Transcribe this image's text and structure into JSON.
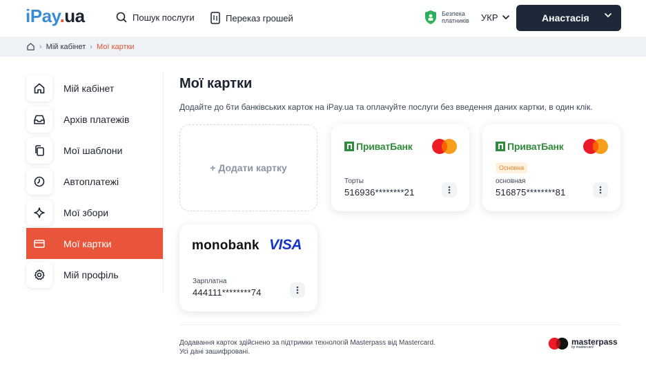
{
  "header": {
    "logo": {
      "part1": "iPay",
      "part2": ".",
      "part3": "ua"
    },
    "search_label": "Пошук послуги",
    "transfer_label": "Переказ грошей",
    "safety_line1": "Безпека",
    "safety_line2": "платників",
    "lang": "УКР",
    "user_name": "Анастасія"
  },
  "breadcrumb": {
    "items": [
      "Мій кабінет",
      "Мої картки"
    ]
  },
  "sidebar": {
    "items": [
      {
        "label": "Мій кабінет",
        "icon": "home-icon"
      },
      {
        "label": "Архів платежів",
        "icon": "inbox-icon"
      },
      {
        "label": "Мої шаблони",
        "icon": "copy-icon"
      },
      {
        "label": "Автоплатежі",
        "icon": "clock-icon"
      },
      {
        "label": "Мої збори",
        "icon": "sparkle-icon"
      },
      {
        "label": "Мої картки",
        "icon": "card-icon",
        "active": true
      },
      {
        "label": "Мій профіль",
        "icon": "gear-icon"
      }
    ]
  },
  "main": {
    "title": "Мої картки",
    "subtitle": "Додайте до 6ти банківських карток на iPay.ua та оплачуйте послуги без введення даних картки, в один клік.",
    "add_card_label": "+ Додати картку",
    "cards": [
      {
        "bank": "ПриватБанк",
        "name": "Торты",
        "number": "516936********21",
        "network": "mastercard"
      },
      {
        "bank": "ПриватБанк",
        "badge": "Основна",
        "name": "основная",
        "number": "516875********81",
        "network": "mastercard"
      },
      {
        "bank": "monobank",
        "network_label": "VISA",
        "name": "Зарплатна",
        "number": "444111********74",
        "network": "visa"
      }
    ]
  },
  "footer": {
    "line1": "Додавання карток здійснено за підтримки технологій Masterpass від Mastercard.",
    "line2": "Усі дані зашифровані.",
    "mp_word": "masterpass",
    "mp_sub": "by mastercard"
  },
  "colors": {
    "accent": "#e9553a",
    "dark": "#1d2838",
    "privat_green": "#2f8a3b",
    "visa_blue": "#1434cb"
  }
}
